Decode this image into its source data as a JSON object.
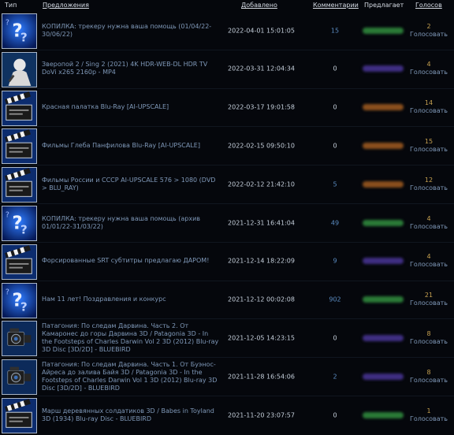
{
  "headers": {
    "type": "Тип",
    "offer_title": "Предложения",
    "added": "Добавлено",
    "comments": "Комментарии",
    "offers": "Предлагает",
    "votes": "Голосов"
  },
  "colors": {
    "link": "#7f98b8",
    "votes_number": "#c5a050",
    "comments_link": "#5b8cc2",
    "green_blob": "#2a7a37",
    "purple_blob": "#3f2e82",
    "orange_blob": "#8a4f1d"
  },
  "rows": [
    {
      "icon": "question-icon",
      "title": "КОПИЛКА: трекеру нужна ваша помощь (01/04/22-30/06/22)",
      "date": "2022-04-01 15:01:05",
      "comments": "15",
      "offer_blob": "green",
      "votes": "2",
      "vote_label": "Голосовать"
    },
    {
      "icon": "person-icon",
      "title": "Зверопой 2 / Sing 2 (2021) 4K HDR-WEB-DL HDR TV DoVi x265 2160p - MP4",
      "date": "2022-03-31 12:04:34",
      "comments": "0",
      "offer_blob": "purple",
      "votes": "4",
      "vote_label": "Голосовать"
    },
    {
      "icon": "clapper-icon",
      "title": "Красная палатка Blu-Ray [AI-UPSCALE]",
      "date": "2022-03-17 19:01:58",
      "comments": "0",
      "offer_blob": "orange",
      "votes": "14",
      "vote_label": "Голосовать"
    },
    {
      "icon": "clapper-icon",
      "title": "Фильмы Глеба Панфилова Blu-Ray [AI-UPSCALE]",
      "date": "2022-02-15 09:50:10",
      "comments": "0",
      "offer_blob": "orange",
      "votes": "15",
      "vote_label": "Голосовать"
    },
    {
      "icon": "clapper-icon",
      "title": "Фильмы России и СССР AI-UPSCALE 576 > 1080 (DVD > BLU_RAY)",
      "date": "2022-02-12 21:42:10",
      "comments": "5",
      "offer_blob": "orange",
      "votes": "12",
      "vote_label": "Голосовать"
    },
    {
      "icon": "question-icon",
      "title": "КОПИЛКА: трекеру нужна ваша помощь (архив 01/01/22-31/03/22)",
      "date": "2021-12-31 16:41:04",
      "comments": "49",
      "offer_blob": "green",
      "votes": "4",
      "vote_label": "Голосовать"
    },
    {
      "icon": "clapper-icon",
      "title": "Форсированные SRT субтитры предлагаю ДАРОМ!",
      "date": "2021-12-14 18:22:09",
      "comments": "9",
      "offer_blob": "purple",
      "votes": "4",
      "vote_label": "Голосовать"
    },
    {
      "icon": "question-icon",
      "title": "Нам 11 лет! Поздравления и конкурс",
      "date": "2021-12-12 00:02:08",
      "comments": "902",
      "offer_blob": "green",
      "votes": "21",
      "vote_label": "Голосовать"
    },
    {
      "icon": "camera-icon",
      "title": "Патагония: По следам Дарвина. Часть 2. От Камаронес до горы Дарвина 3D / Patagonia 3D - In the Footsteps of Charles Darwin Vol 2 3D (2012) Blu-ray 3D Disc [3D/2D] - BLUEBIRD",
      "date": "2021-12-05 14:23:15",
      "comments": "0",
      "offer_blob": "purple",
      "votes": "8",
      "vote_label": "Голосовать"
    },
    {
      "icon": "camera-icon",
      "title": "Патагония: По следам Дарвина. Часть 1. От Буэнос-Айреса до залива Байя 3D / Patagonia 3D - In the Footsteps of Charles Darwin Vol 1 3D (2012) Blu-ray 3D Disc [3D/2D] - BLUEBIRD",
      "date": "2021-11-28 16:54:06",
      "comments": "2",
      "offer_blob": "purple",
      "votes": "8",
      "vote_label": "Голосовать"
    },
    {
      "icon": "clapper-icon",
      "title": "Марш деревянных солдатиков 3D / Babes in Toyland 3D (1934) Blu-ray Disc - BLUEBIRD",
      "date": "2021-11-20 23:07:57",
      "comments": "0",
      "offer_blob": "green",
      "votes": "1",
      "vote_label": "Голосовать"
    }
  ]
}
